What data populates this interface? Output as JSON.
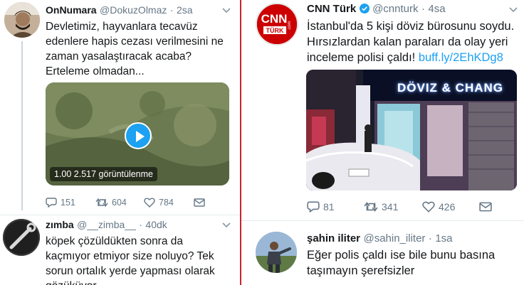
{
  "left": {
    "tweet1": {
      "name": "OnNumara",
      "handle": "@DokuzOlmaz",
      "dot": "·",
      "time": "2sa",
      "text_lines": [
        "Devletimiz, hayvanlara tecavüz",
        "edenlere hapis cezası verilmesini ne",
        "zaman yasalaştıracak acaba?",
        "Erteleme olmadan..."
      ],
      "video_views": "1.00  2.517 görüntülenme",
      "replies": "151",
      "retweets": "604",
      "likes": "784"
    },
    "tweet2": {
      "name": "zımba",
      "handle": "@__zimba__",
      "dot": "·",
      "time": "40dk",
      "text_lines": [
        "köpek çözüldükten sonra da",
        "kaçmıyor etmiyor size noluyo? Tek",
        "sorun ortalık yerde yapması olarak",
        "gözüküyor"
      ]
    }
  },
  "right": {
    "tweet1": {
      "name": "CNN Türk",
      "handle": "@cnnturk",
      "dot": "·",
      "time": "4sa",
      "logo_text": "CNN",
      "logo_sub": "TÜRK",
      "logo_com": ".com",
      "text_line1": "İstanbul'da 5 kişi döviz bürosunu soydu.",
      "text_line2": "Hırsızlardan kalan paraları da olay yeri",
      "text_line3_prefix": "inceleme polisi çaldı! ",
      "text_link": "buff.ly/2EhKDg8",
      "sign_text": "DÖVIZ & CHANG",
      "replies": "81",
      "retweets": "341",
      "likes": "426"
    },
    "tweet2": {
      "name": "şahin iliter",
      "handle": "@sahin_iliter",
      "dot": "·",
      "time": "1sa",
      "text_lines": [
        "Eğer polis çaldı ise bile bunu basına",
        "taşımayın şerefsizler"
      ]
    }
  },
  "colors": {
    "accent": "#1da1f2",
    "divider": "#c8232c",
    "cnn_red": "#cc0000",
    "verified": "#1da1f2"
  }
}
